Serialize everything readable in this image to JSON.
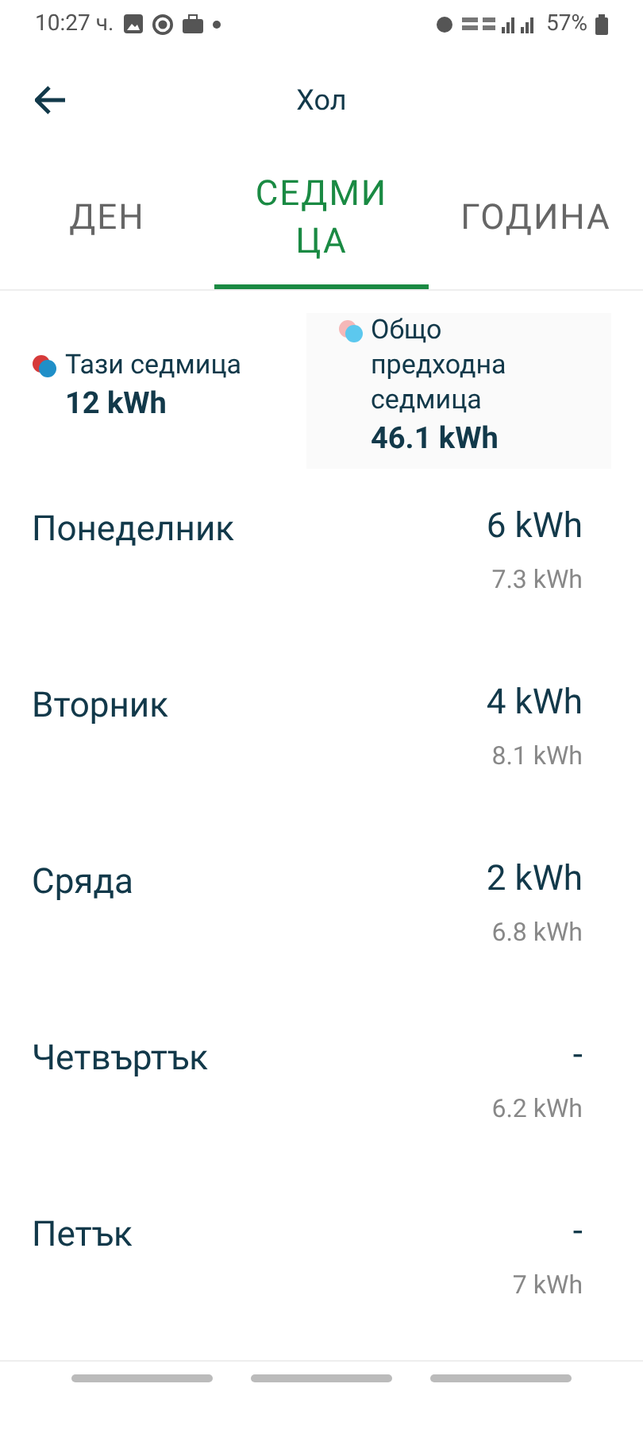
{
  "status_bar": {
    "time": "10:27 ч.",
    "battery": "57%"
  },
  "header": {
    "title": "Хол"
  },
  "tabs": [
    {
      "label": "ДЕН",
      "selected": false
    },
    {
      "label": "СЕДМИЦА",
      "selected": true
    },
    {
      "label": "ГОДИНА",
      "selected": false
    }
  ],
  "legend": [
    {
      "label": "Тази седмица",
      "value": "12 kWh",
      "dots": [
        {
          "color": "#d63a3a"
        },
        {
          "color": "#1f8fc8"
        }
      ]
    },
    {
      "label": "Общо предходна седмица",
      "value": "46.1 kWh",
      "dots": [
        {
          "color": "#f5b8b8"
        },
        {
          "color": "#5cc8ee"
        }
      ]
    }
  ],
  "days": [
    {
      "name": "Понеделник",
      "value": "6 kWh",
      "previous": "7.3 kWh"
    },
    {
      "name": "Вторник",
      "value": "4 kWh",
      "previous": "8.1 kWh"
    },
    {
      "name": "Сряда",
      "value": "2 kWh",
      "previous": "6.8 kWh"
    },
    {
      "name": "Четвъртък",
      "value": "-",
      "previous": "6.2 kWh"
    },
    {
      "name": "Петък",
      "value": "-",
      "previous": "7 kWh"
    }
  ]
}
